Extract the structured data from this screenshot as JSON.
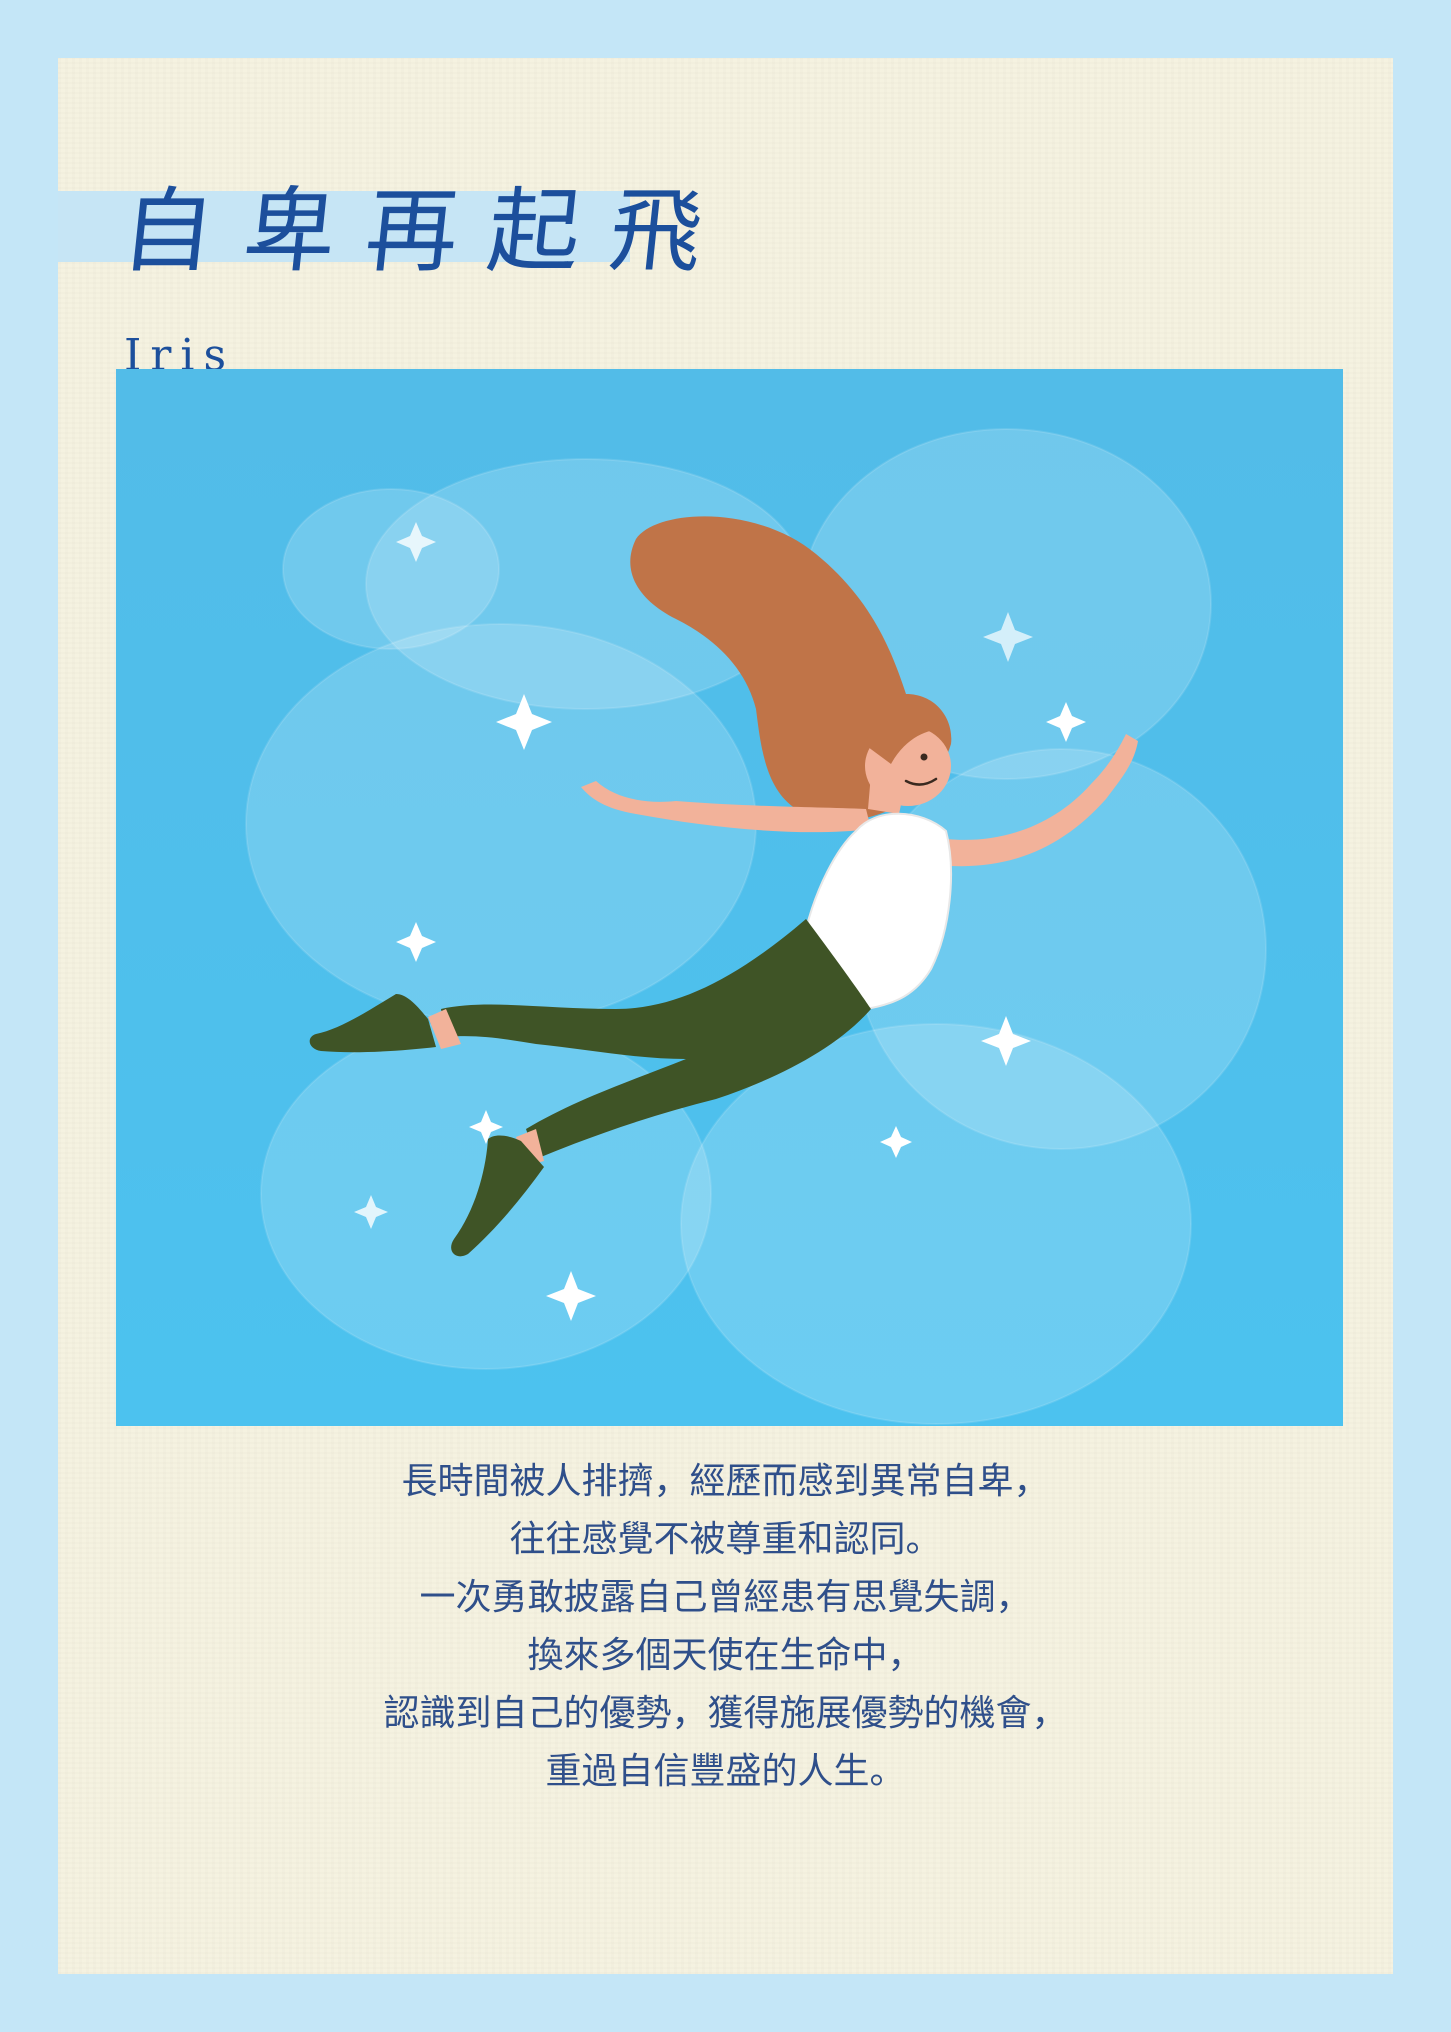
{
  "title": "自卑再起飛",
  "author": "Iris",
  "story_lines": [
    "長時間被人排擠，經歷而感到異常自卑，",
    "往往感覺不被尊重和認同。",
    "一次勇敢披露自己曾經患有思覺失調，",
    "換來多個天使在生命中，",
    "認識到自己的優勢，獲得施展優勢的機會，",
    "重過自信豐盛的人生。"
  ],
  "colors": {
    "page_background": "#c4e6f7",
    "paper": "#f5f2e0",
    "title_ink": "#1c4f9c",
    "title_band": "#c6e5f5",
    "sky": "#4ebde9",
    "hair": "#c07448",
    "skin": "#f2b29a",
    "shirt": "#ffffff",
    "pants": "#3f5426",
    "story_text": "#2f4f8a"
  },
  "illustration": {
    "subject": "flying-woman",
    "decorations": [
      "cloud-blob",
      "sparkle-star"
    ]
  }
}
